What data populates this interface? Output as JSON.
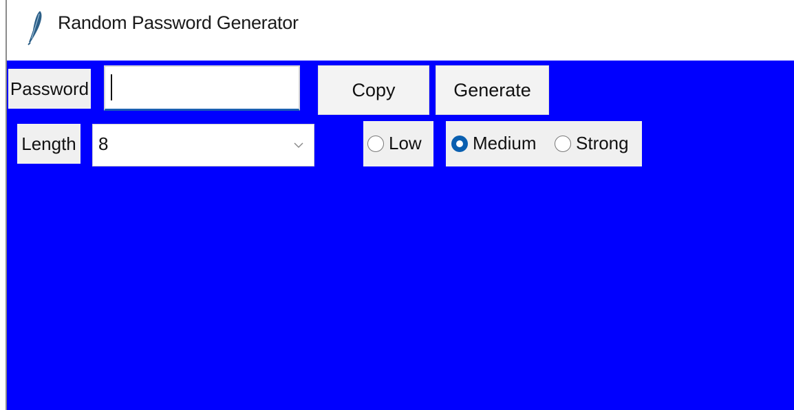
{
  "window": {
    "title": "Random Password Generator",
    "icon": "feather-icon",
    "background_color": "#0000ff"
  },
  "password": {
    "label": "Password",
    "value": ""
  },
  "buttons": {
    "copy_label": "Copy",
    "generate_label": "Generate"
  },
  "length": {
    "label": "Length",
    "selected": "8"
  },
  "strength": {
    "options": [
      "Low",
      "Medium",
      "Strong"
    ],
    "selected": "Medium",
    "accent_color": "#0a5fb0"
  }
}
